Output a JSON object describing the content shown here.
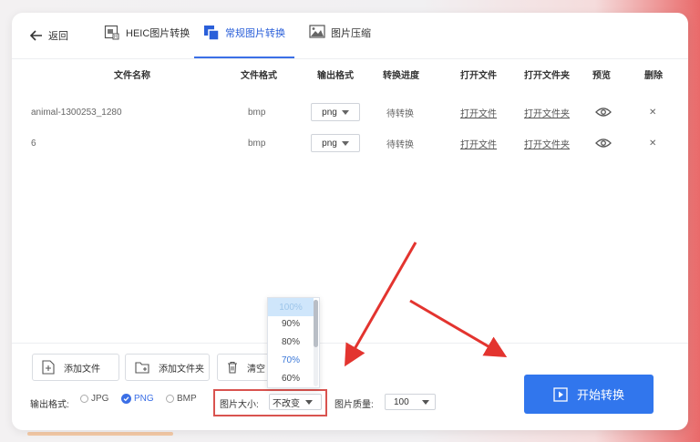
{
  "nav": {
    "back_label": "返回",
    "tabs": [
      {
        "label": "HEIC图片转换",
        "icon": "heic-image-icon",
        "active": false
      },
      {
        "label": "常规图片转换",
        "icon": "convert-image-icon",
        "active": true
      },
      {
        "label": "图片压缩",
        "icon": "image-compress-icon",
        "active": false
      }
    ]
  },
  "table": {
    "headers": {
      "name": "文件名称",
      "format": "文件格式",
      "output": "输出格式",
      "progress": "转换进度",
      "open_file": "打开文件",
      "open_folder": "打开文件夹",
      "preview": "预览",
      "delete": "删除"
    },
    "rows": [
      {
        "name": "animal-1300253_1280",
        "format": "bmp",
        "output": "png",
        "progress": "待转换",
        "open_file": "打开文件",
        "open_folder": "打开文件夹"
      },
      {
        "name": "6",
        "format": "bmp",
        "output": "png",
        "progress": "待转换",
        "open_file": "打开文件",
        "open_folder": "打开文件夹"
      }
    ]
  },
  "actions": {
    "add_file": "添加文件",
    "add_folder": "添加文件夹",
    "clear": "清空"
  },
  "options": {
    "output_format_label": "输出格式:",
    "formats": [
      {
        "label": "JPG",
        "checked": false
      },
      {
        "label": "PNG",
        "checked": true
      },
      {
        "label": "BMP",
        "checked": false
      }
    ],
    "size_label": "图片大小:",
    "size_value": "不改变",
    "quality_label": "图片质量:",
    "quality_value": "100"
  },
  "size_dropdown": {
    "items": [
      "100%",
      "90%",
      "80%",
      "70%",
      "60%"
    ],
    "highlighted_index": 0,
    "hover_index": 3
  },
  "start_button": "开始转换",
  "colors": {
    "accent": "#3176ed",
    "annotation_red": "#e3342f",
    "delete_red": "#e05b5b"
  }
}
